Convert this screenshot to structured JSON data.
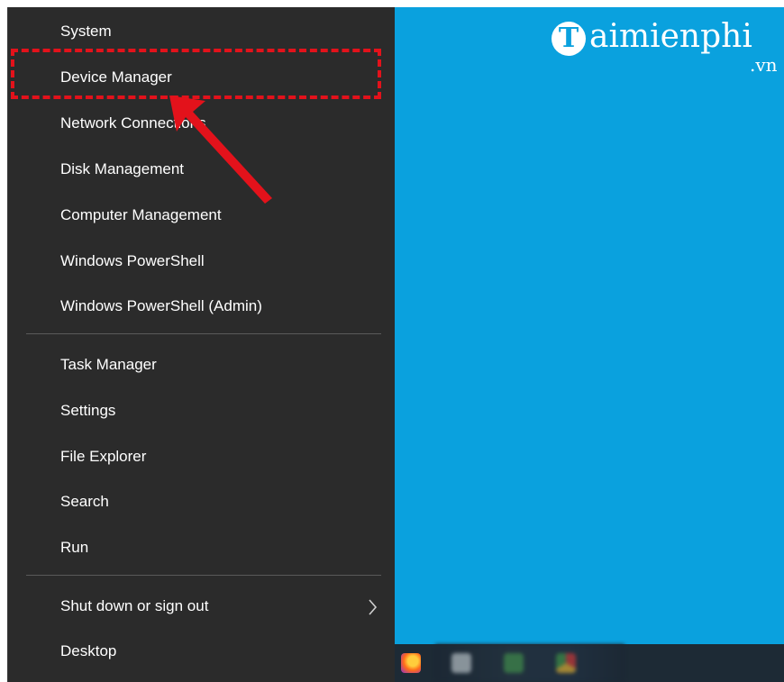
{
  "menu": {
    "groups": [
      [
        {
          "label": "System"
        },
        {
          "label": "Device Manager"
        },
        {
          "label": "Network Connections"
        },
        {
          "label": "Disk Management"
        },
        {
          "label": "Computer Management"
        },
        {
          "label": "Windows PowerShell"
        },
        {
          "label": "Windows PowerShell (Admin)"
        }
      ],
      [
        {
          "label": "Task Manager"
        },
        {
          "label": "Settings"
        },
        {
          "label": "File Explorer"
        },
        {
          "label": "Search"
        },
        {
          "label": "Run"
        }
      ],
      [
        {
          "label": "Shut down or sign out",
          "submenu_icon": "chevron-right-icon"
        },
        {
          "label": "Desktop"
        }
      ]
    ]
  },
  "watermark": {
    "brand": "aimienphi",
    "suffix": ".vn"
  },
  "annotation": {
    "highlight_color": "#e3121b"
  },
  "colors": {
    "menu_bg": "#2b2b2b",
    "desktop_bg": "#0aa1de",
    "taskbar_bg": "#1d2a35"
  }
}
